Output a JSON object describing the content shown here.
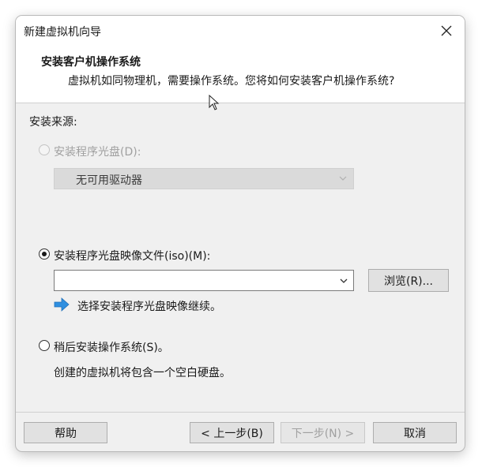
{
  "window": {
    "title": "新建虚拟机向导"
  },
  "header": {
    "title": "安装客户机操作系统",
    "subtitle": "虚拟机如同物理机，需要操作系统。您将如何安装客户机操作系统?"
  },
  "section": {
    "label": "安装来源:"
  },
  "option_disc": {
    "label": "安装程序光盘(D):",
    "drive_select_value": "无可用驱动器",
    "selected": false,
    "enabled": false
  },
  "option_iso": {
    "label": "安装程序光盘映像文件(iso)(M):",
    "path_value": "",
    "browse_label": "浏览(R)...",
    "hint": "选择安装程序光盘映像继续。",
    "selected": true
  },
  "option_later": {
    "label": "稍后安装操作系统(S)。",
    "description": "创建的虚拟机将包含一个空白硬盘。",
    "selected": false
  },
  "footer": {
    "help_label": "帮助",
    "back_label": "< 上一步(B)",
    "next_label": "下一步(N) >",
    "cancel_label": "取消"
  },
  "colors": {
    "accent_arrow": "#2f8fe0",
    "dialog_bg": "#f0f0f0"
  }
}
